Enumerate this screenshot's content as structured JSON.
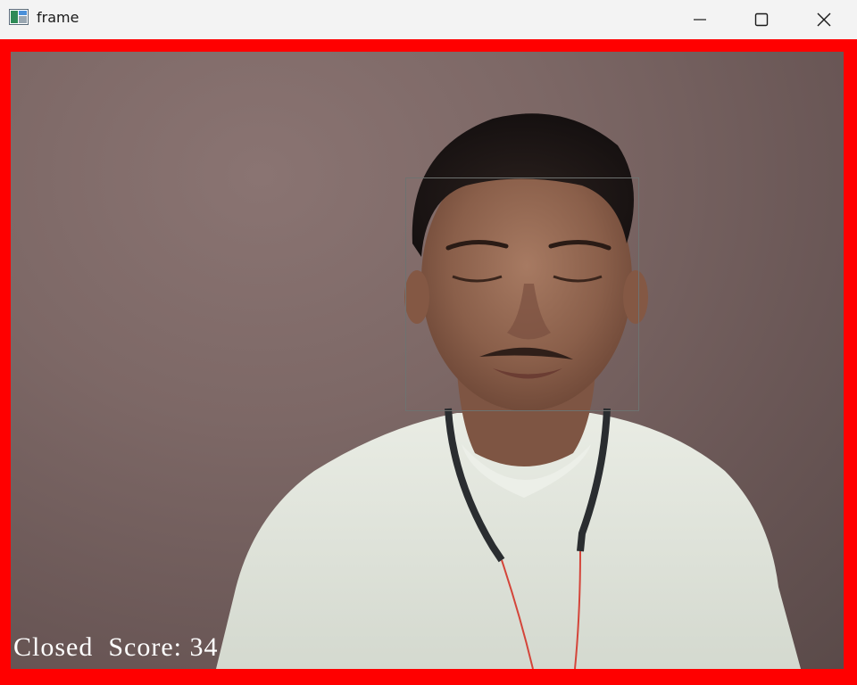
{
  "window": {
    "title": "frame"
  },
  "titlebar": {
    "icons": {
      "app": "app-icon",
      "minimize": "minimize-icon",
      "maximize": "maximize-icon",
      "close": "close-icon"
    }
  },
  "overlay": {
    "status_label": "Closed",
    "score_label": "Score:",
    "score_value": "34"
  },
  "colors": {
    "border": "#ff0000",
    "overlay_text": "#ffffff",
    "face_box": "#6e7270",
    "titlebar": "#f3f3f3"
  }
}
